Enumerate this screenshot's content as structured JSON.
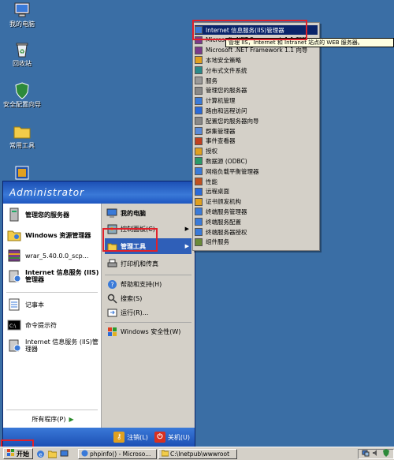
{
  "desktop": {
    "icons": [
      {
        "label": "我的电脑"
      },
      {
        "label": "回收站"
      },
      {
        "label": "安全配置向导"
      },
      {
        "label": "常用工具"
      }
    ]
  },
  "start_menu": {
    "user": "Administrator",
    "pinned": [
      {
        "label": "管理您的服务器"
      },
      {
        "label": "Windows 资源管理器"
      },
      {
        "label": "wrar_5.40.0.0_scp..."
      },
      {
        "label": "Internet 信息服务 (IIS)管理器"
      }
    ],
    "recent": [
      {
        "label": "记事本"
      },
      {
        "label": "命令提示符"
      },
      {
        "label": "Internet 信息服务 (IIS)管理器"
      }
    ],
    "all_programs": "所有程序(P)",
    "right_items": [
      {
        "label": "我的电脑"
      },
      {
        "label": "控制面板(C)"
      },
      {
        "label": "管理工具"
      },
      {
        "label": "打印机和传真"
      },
      {
        "label": "帮助和支持(H)"
      },
      {
        "label": "搜索(S)"
      },
      {
        "label": "运行(R)..."
      },
      {
        "label": "Windows 安全性(W)"
      }
    ],
    "logoff": "注销(L)",
    "shutdown": "关机(U)"
  },
  "submenu": {
    "items": [
      {
        "label": "Internet 信息服务(IIS)管理器"
      },
      {
        "label": "Microsoft .NET Framework 1.1 配置"
      },
      {
        "label": "Microsoft .NET Framework 1.1 向导"
      },
      {
        "label": "本地安全策略"
      },
      {
        "label": "分布式文件系统"
      },
      {
        "label": "服务"
      },
      {
        "label": "管理您的服务器"
      },
      {
        "label": "计算机管理"
      },
      {
        "label": "路由和远程访问"
      },
      {
        "label": "配置您的服务器向导"
      },
      {
        "label": "群集管理器"
      },
      {
        "label": "事件查看器"
      },
      {
        "label": "授权"
      },
      {
        "label": "数据源 (ODBC)"
      },
      {
        "label": "网络负载平衡管理器"
      },
      {
        "label": "性能"
      },
      {
        "label": "远程桌面"
      },
      {
        "label": "证书颁发机构"
      },
      {
        "label": "终端服务管理器"
      },
      {
        "label": "终端服务配置"
      },
      {
        "label": "终端服务器授权"
      },
      {
        "label": "组件服务"
      }
    ],
    "tooltip": "管理 IIS，Internet 和 Intranet 站点的 WEB 服务器。"
  },
  "taskbar": {
    "start": "开始",
    "tasks": [
      {
        "label": "phpinfo() - Microso..."
      },
      {
        "label": "C:\\Inetpub\\wwwroot"
      }
    ]
  },
  "colors": {
    "desktop": "#3a6ea5",
    "menu_blue": "#1c4fb4",
    "highlight": "#0a246a",
    "annotation_red": "#e0202a"
  }
}
